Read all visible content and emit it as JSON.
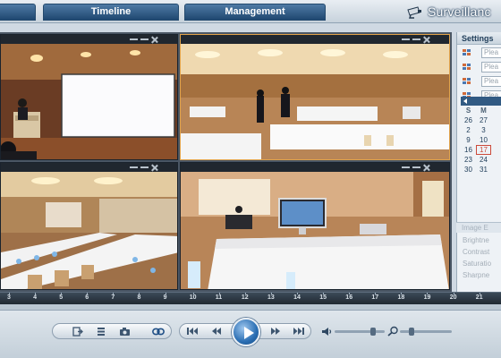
{
  "tabs": {
    "timeline": "Timeline",
    "management": "Management"
  },
  "brand": {
    "name": "Surveillanc",
    "icon": "camera-icon"
  },
  "viewports": [
    {
      "id": "cam-1",
      "scene": "conference stage with projector screen and podium"
    },
    {
      "id": "cam-2",
      "scene": "banquet hall with tables and standing people"
    },
    {
      "id": "cam-3",
      "scene": "long conference room with chairs and water bottles"
    },
    {
      "id": "cam-4",
      "scene": "white draped table with computer monitor"
    }
  ],
  "settings": {
    "title": "Settings",
    "fields": [
      {
        "placeholder": "Plea"
      },
      {
        "placeholder": "Plea"
      },
      {
        "placeholder": "Plea"
      },
      {
        "placeholder": "Plea"
      }
    ]
  },
  "calendar": {
    "dow": [
      "S",
      "M"
    ],
    "rows": [
      [
        "26",
        "27"
      ],
      [
        "2",
        "3"
      ],
      [
        "9",
        "10"
      ],
      [
        "16",
        "17"
      ],
      [
        "23",
        "24"
      ],
      [
        "30",
        "31"
      ]
    ],
    "selected": "17"
  },
  "image_panel": {
    "title": "Image E",
    "items": [
      "Brightne",
      "Contrast",
      "Saturatio",
      "Sharpne"
    ]
  },
  "ruler": {
    "ticks": [
      "3",
      "4",
      "5",
      "6",
      "7",
      "8",
      "9",
      "10",
      "11",
      "12",
      "13",
      "14",
      "15",
      "16",
      "17",
      "18",
      "19",
      "20",
      "21"
    ]
  },
  "controls": {
    "volume_level": 0.8,
    "zoom_level": 0.2,
    "accent": "#2a6eb3"
  }
}
